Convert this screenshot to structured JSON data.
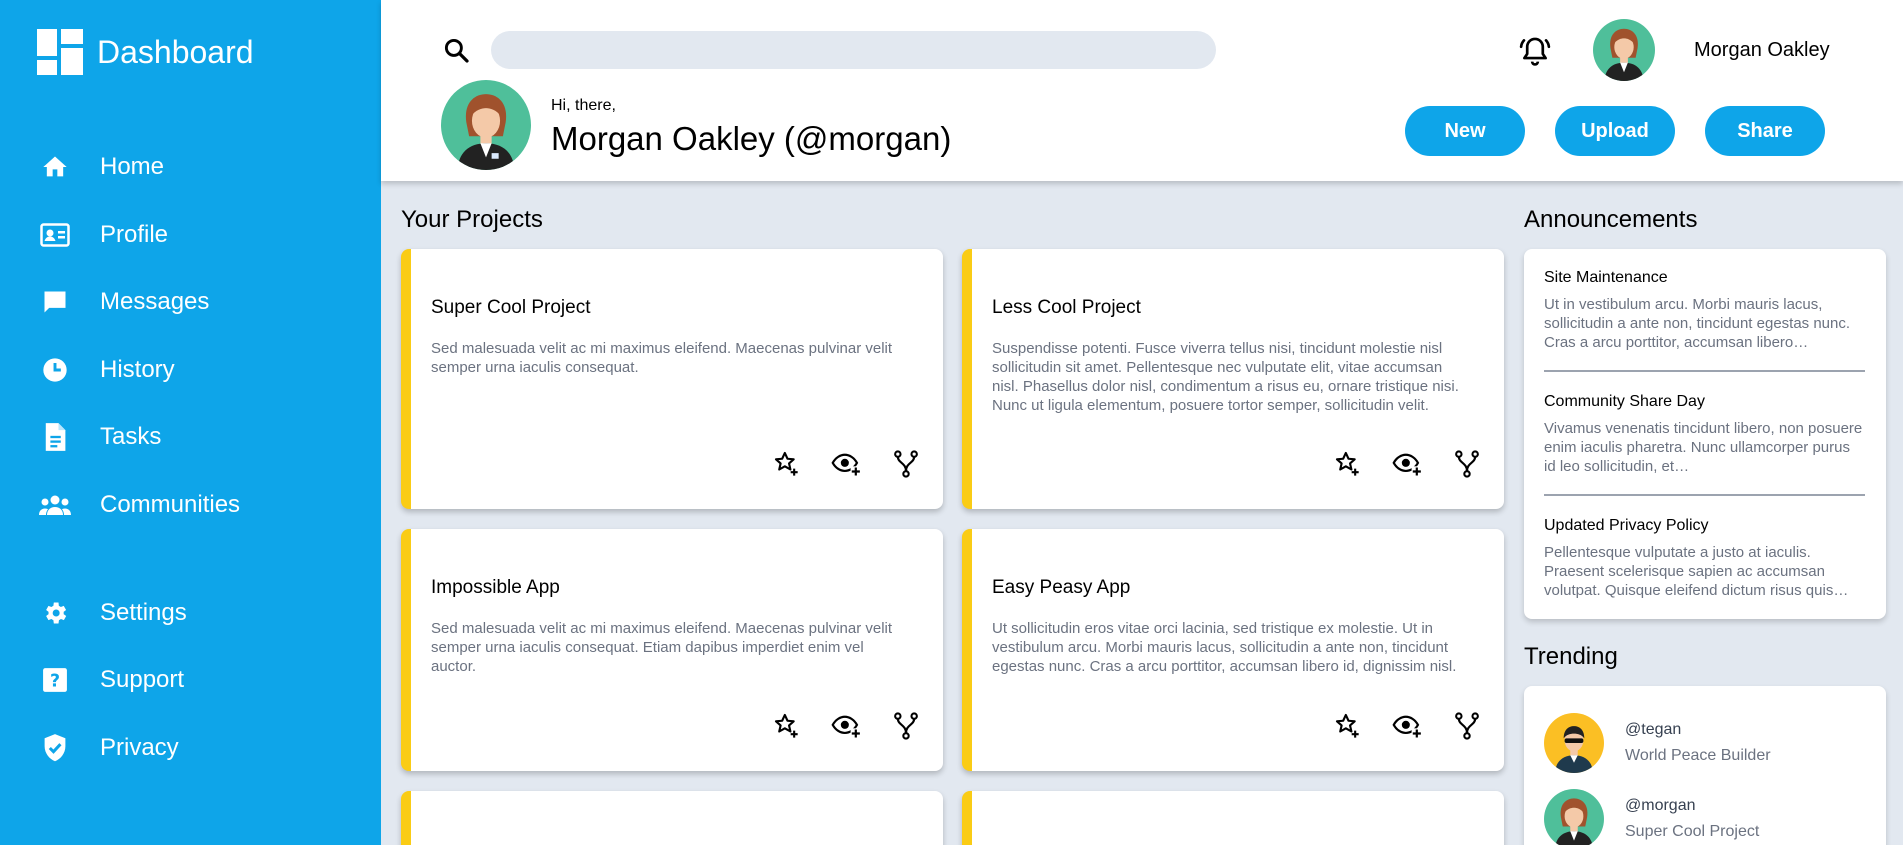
{
  "sidebar": {
    "title": "Dashboard",
    "items": [
      {
        "label": "Home",
        "icon": "home-icon"
      },
      {
        "label": "Profile",
        "icon": "id-card-icon"
      },
      {
        "label": "Messages",
        "icon": "message-icon"
      },
      {
        "label": "History",
        "icon": "clock-icon"
      },
      {
        "label": "Tasks",
        "icon": "document-icon"
      },
      {
        "label": "Communities",
        "icon": "people-icon"
      },
      {
        "label": "Settings",
        "icon": "gear-icon"
      },
      {
        "label": "Support",
        "icon": "help-icon"
      },
      {
        "label": "Privacy",
        "icon": "shield-check-icon"
      }
    ]
  },
  "header": {
    "search_placeholder": "",
    "username": "Morgan Oakley",
    "greeting": "Hi, there,",
    "display_name": "Morgan Oakley (@morgan)",
    "buttons": {
      "new": "New",
      "upload": "Upload",
      "share": "Share"
    }
  },
  "projects": {
    "heading": "Your Projects",
    "items": [
      {
        "title": "Super Cool Project",
        "description": "Sed malesuada velit ac mi maximus eleifend. Maecenas pulvinar velit semper urna iaculis consequat."
      },
      {
        "title": "Less Cool Project",
        "description": "Suspendisse potenti. Fusce viverra tellus nisi, tincidunt molestie nisl sollicitudin sit amet. Pellentesque nec vulputate elit, vitae accumsan nisl. Phasellus dolor nisl, condimentum a risus eu, ornare tristique nisi. Nunc ut ligula elementum, posuere tortor semper, sollicitudin velit."
      },
      {
        "title": "Impossible App",
        "description": "Sed malesuada velit ac mi maximus eleifend. Maecenas pulvinar velit semper urna iaculis consequat. Etiam dapibus imperdiet enim vel auctor."
      },
      {
        "title": "Easy Peasy App",
        "description": "Ut sollicitudin eros vitae orci lacinia, sed tristique ex molestie. Ut in vestibulum arcu. Morbi mauris lacus, sollicitudin a ante non, tincidunt egestas nunc. Cras a arcu porttitor, accumsan libero id, dignissim nisl."
      }
    ]
  },
  "announcements": {
    "heading": "Announcements",
    "items": [
      {
        "title": "Site Maintenance",
        "text": "Ut in vestibulum arcu. Morbi mauris lacus, sollicitudin a ante non, tincidunt egestas nunc. Cras a arcu porttitor, accumsan libero…"
      },
      {
        "title": "Community Share Day",
        "text": "Vivamus venenatis tincidunt libero, non posuere enim iaculis pharetra. Nunc ullamcorper purus id leo sollicitudin, et…"
      },
      {
        "title": "Updated Privacy Policy",
        "text": "Pellentesque vulputate a justo at iaculis. Praesent scelerisque sapien ac accumsan volutpat. Quisque eleifend dictum risus quis…"
      }
    ]
  },
  "trending": {
    "heading": "Trending",
    "items": [
      {
        "handle": "@tegan",
        "project": "World Peace Builder"
      },
      {
        "handle": "@morgan",
        "project": "Super Cool Project"
      }
    ]
  },
  "colors": {
    "accent": "#0ea5e9",
    "card_border": "#facc15",
    "background": "#e2e8f0"
  }
}
